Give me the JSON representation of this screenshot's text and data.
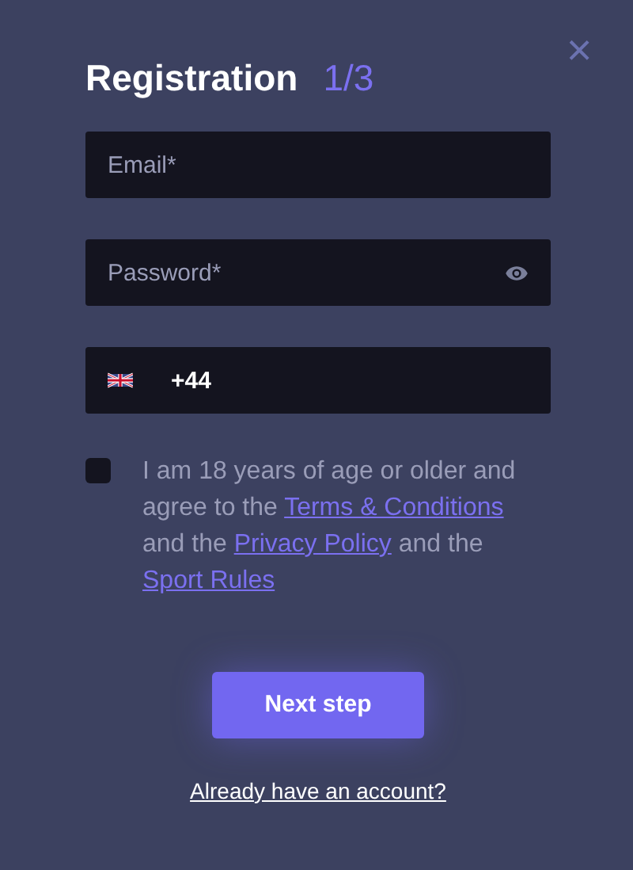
{
  "close_button": "×",
  "title": "Registration",
  "step": "1/3",
  "fields": [
    {
      "kind": "email",
      "placeholder": "Email*"
    },
    {
      "kind": "password",
      "placeholder": "Password*"
    },
    {
      "kind": "phone",
      "value": "+44"
    }
  ],
  "consent": {
    "checked": false,
    "parts": [
      {
        "kind": "text",
        "text": "I am 18 years of age or older and agree to the "
      },
      {
        "kind": "link",
        "text": "Terms & Conditions"
      },
      {
        "kind": "text",
        "text": " and the "
      },
      {
        "kind": "link",
        "text": "Privacy Policy"
      },
      {
        "kind": "text",
        "text": " and the "
      },
      {
        "kind": "link",
        "text": "Sport Rules"
      }
    ]
  },
  "next_button": "Next step",
  "login_link": "Already have an account?"
}
